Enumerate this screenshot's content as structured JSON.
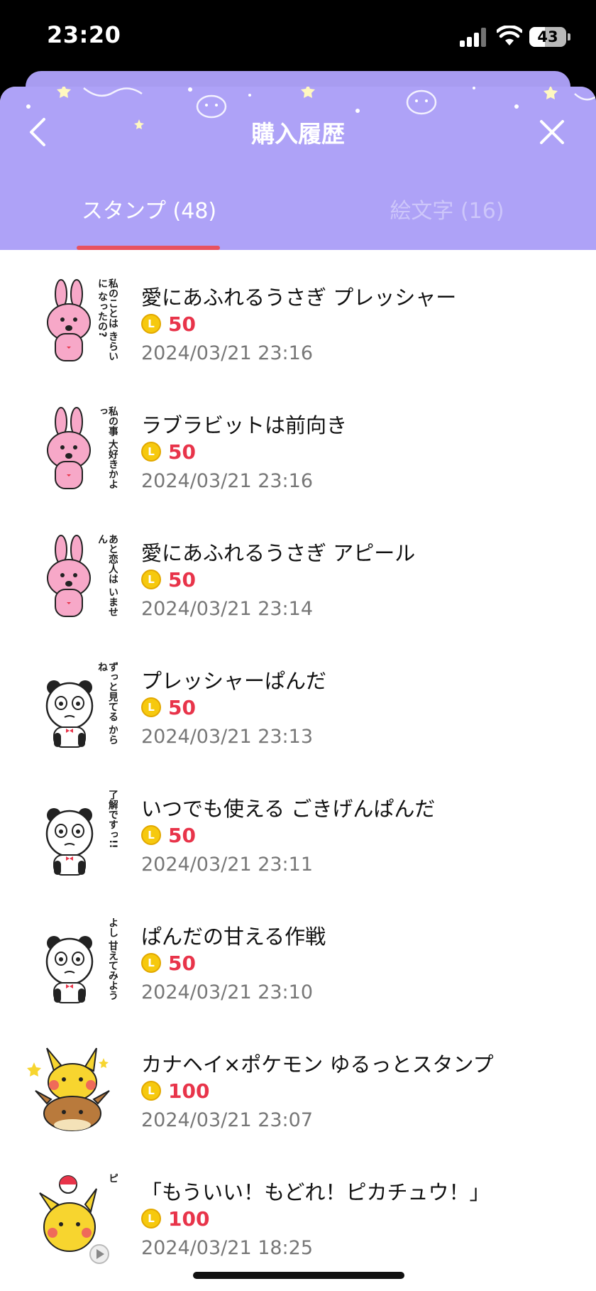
{
  "status_bar": {
    "time": "23:20",
    "battery": "43",
    "battery_level": 0.43
  },
  "header": {
    "title": "購入履歴"
  },
  "tabs": [
    {
      "label": "スタンプ (48)",
      "active": true
    },
    {
      "label": "絵文字 (16)",
      "active": false
    }
  ],
  "items": [
    {
      "name": "愛にあふれるうさぎ プレッシャー",
      "coin": "L",
      "price": "50",
      "date": "2024/03/21 23:16",
      "thumb": "pink-rabbit"
    },
    {
      "name": "ラブラビットは前向き",
      "coin": "L",
      "price": "50",
      "date": "2024/03/21 23:16",
      "thumb": "pink-rabbit"
    },
    {
      "name": "愛にあふれるうさぎ アピール",
      "coin": "L",
      "price": "50",
      "date": "2024/03/21 23:14",
      "thumb": "pink-rabbit"
    },
    {
      "name": "プレッシャーぱんだ",
      "coin": "L",
      "price": "50",
      "date": "2024/03/21 23:13",
      "thumb": "panda"
    },
    {
      "name": "いつでも使える ごきげんぱんだ",
      "coin": "L",
      "price": "50",
      "date": "2024/03/21 23:11",
      "thumb": "panda"
    },
    {
      "name": "ぱんだの甘える作戦",
      "coin": "L",
      "price": "50",
      "date": "2024/03/21 23:10",
      "thumb": "panda"
    },
    {
      "name": "カナヘイ×ポケモン ゆるっとスタンプ",
      "coin": "L",
      "price": "100",
      "date": "2024/03/21 23:07",
      "thumb": "pikachu-eevee"
    },
    {
      "name": "「もういい！もどれ！ピカチュウ！」",
      "coin": "L",
      "price": "100",
      "date": "2024/03/21 18:25",
      "thumb": "pikachu"
    }
  ],
  "thumb_text": [
    "私のことは きらいに なったの?",
    "私の事 大好きかよっ",
    "あと恋人は いません",
    "ずっと見てる からね",
    "了解ですっ!!",
    "よし 甘えてみよう",
    "",
    "ピ"
  ],
  "colors": {
    "header": "#aea2f7",
    "indicator": "#e8525f",
    "price": "#e8344a",
    "coin": "#f6c90e"
  }
}
